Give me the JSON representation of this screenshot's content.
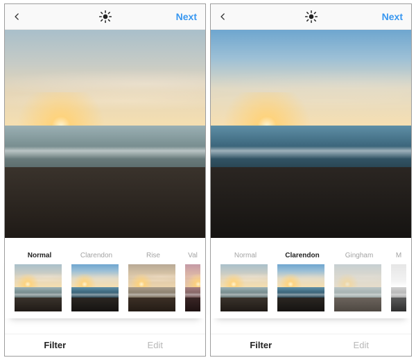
{
  "colors": {
    "accent": "#3897f0",
    "muted": "#a3a3a3",
    "text": "#222222"
  },
  "screens": [
    {
      "id": "left",
      "header": {
        "back_icon": "chevron-left",
        "center_icon": "brightness",
        "next_label": "Next"
      },
      "photo_filter": "normal",
      "filters": [
        {
          "name": "Normal",
          "style": "normal",
          "active": true
        },
        {
          "name": "Clarendon",
          "style": "clarendon",
          "active": false
        },
        {
          "name": "Rise",
          "style": "rise",
          "active": false
        },
        {
          "name": "Val",
          "style": "valencia",
          "active": false,
          "partial": true
        }
      ],
      "tabs": {
        "filter_label": "Filter",
        "edit_label": "Edit",
        "active": "filter"
      }
    },
    {
      "id": "right",
      "header": {
        "back_icon": "chevron-left",
        "center_icon": "brightness",
        "next_label": "Next"
      },
      "photo_filter": "clarendon",
      "filters": [
        {
          "name": "Normal",
          "style": "normal",
          "active": false
        },
        {
          "name": "Clarendon",
          "style": "clarendon",
          "active": true
        },
        {
          "name": "Gingham",
          "style": "gingham",
          "active": false
        },
        {
          "name": "M",
          "style": "moon",
          "active": false,
          "partial": true
        }
      ],
      "tabs": {
        "filter_label": "Filter",
        "edit_label": "Edit",
        "active": "filter"
      }
    }
  ]
}
